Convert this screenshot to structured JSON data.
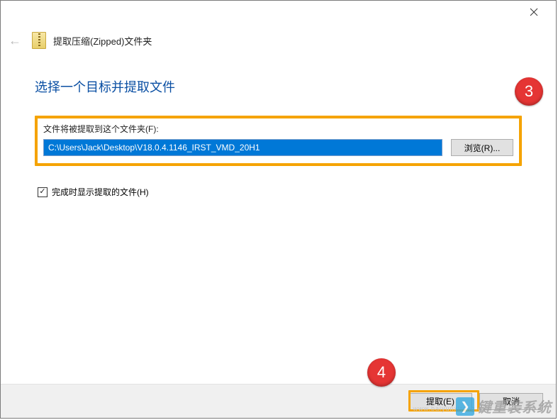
{
  "titlebar": {
    "close_tooltip": "Close"
  },
  "header": {
    "back_glyph": "←",
    "wizard_title": "提取压缩(Zipped)文件夹"
  },
  "content": {
    "heading": "选择一个目标并提取文件",
    "destination_label": "文件将被提取到这个文件夹(F):",
    "destination_path": "C:\\Users\\Jack\\Desktop\\V18.0.4.1146_IRST_VMD_20H1",
    "browse_label": "浏览(R)...",
    "show_files_label": "完成时显示提取的文件(H)",
    "show_files_checked": true
  },
  "footer": {
    "extract_label": "提取(E)",
    "cancel_label": "取消"
  },
  "annotations": {
    "badge_3": "3",
    "badge_4": "4"
  },
  "watermark": {
    "bird_glyph": "❯",
    "brand": "键重装系统",
    "url": "www.baiyunxitong.com"
  }
}
